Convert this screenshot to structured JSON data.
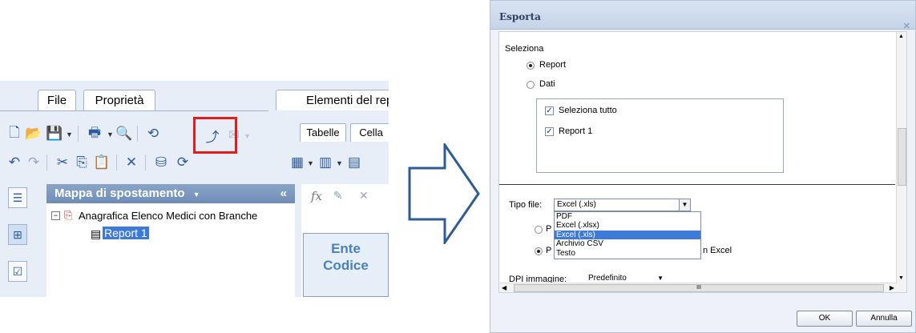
{
  "left": {
    "tabs": [
      "File",
      "Proprietà",
      "Elementi del rep"
    ],
    "subtabs": [
      "Tabelle",
      "Cella"
    ],
    "nav_title": "Mappa di spostamento",
    "nav_collapse": "«",
    "tree": {
      "root": "Anagrafica Elenco Medici con Branche",
      "child": "Report 1"
    },
    "formula_fx": "fx",
    "cell_text": "Ente\nCodice"
  },
  "arrow": {
    "color": "#2e5c94"
  },
  "dialog": {
    "title": "Esporta",
    "close_glyph": "✕",
    "select_heading": "Seleziona",
    "radio_report": "Report",
    "radio_dati": "Dati",
    "check_all": "Seleziona tutto",
    "check_report1": "Report 1",
    "file_type_label": "Tipo file:",
    "file_type_value": "Excel (.xls)",
    "file_type_options": [
      "PDF",
      "Excel (.xlsx)",
      "Excel (.xls)",
      "Archivio CSV",
      "Testo"
    ],
    "file_type_selected_index": 2,
    "partial_p1": "P",
    "partial_p2": "P",
    "partial_excel": "n Excel",
    "dpi_label": "DPI immagine:",
    "dpi_value": "Predefinito",
    "hscroll_mid": "III",
    "ok": "OK",
    "cancel": "Annulla"
  },
  "colors": {
    "highlight": "#e51b1b",
    "accent": "#3d7ad8"
  }
}
